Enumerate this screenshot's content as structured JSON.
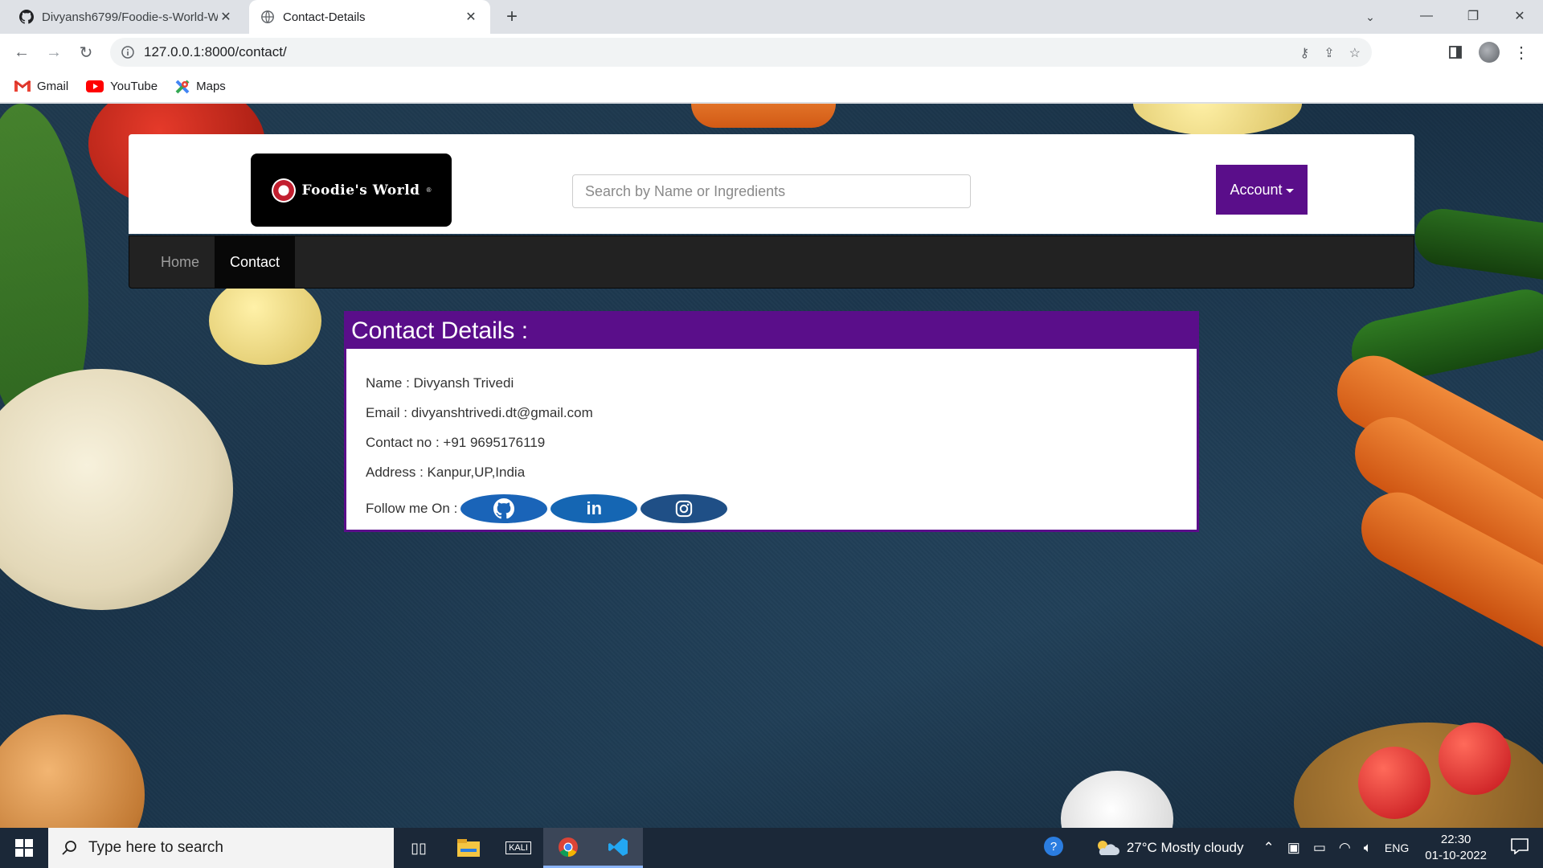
{
  "browser": {
    "tabs": [
      {
        "title": "Divyansh6799/Foodie-s-World-W",
        "active": false
      },
      {
        "title": "Contact-Details",
        "active": true
      }
    ],
    "url": "127.0.0.1:8000/contact/",
    "bookmarks": [
      "Gmail",
      "YouTube",
      "Maps"
    ]
  },
  "site": {
    "logo_text": "Foodie's World",
    "logo_mark": "®",
    "search_placeholder": "Search by Name or Ingredients",
    "account_label": "Account",
    "nav": [
      {
        "label": "Home",
        "active": false
      },
      {
        "label": "Contact",
        "active": true
      }
    ]
  },
  "contact": {
    "heading": "Contact Details :",
    "name_label": "Name : ",
    "name": "Divyansh Trivedi",
    "email_label": "Email : ",
    "email": "divyanshtrivedi.dt@gmail.com",
    "phone_label": "Contact no : ",
    "phone": "+91 9695176119",
    "address_label": "Address : ",
    "address": "Kanpur,UP,India",
    "follow_label": "Follow me On : ",
    "social": [
      "github-icon",
      "linkedin-icon",
      "instagram-icon"
    ],
    "linkedin_text": "in"
  },
  "taskbar": {
    "search_placeholder": "Type here to search",
    "weather": "27°C  Mostly cloudy",
    "lang": "ENG",
    "time": "22:30",
    "date": "01-10-2022",
    "kali_label": "KALI"
  },
  "colors": {
    "accent_purple": "#5a0e8a",
    "navbar": "#222222",
    "social_blue": "#1a64b8"
  }
}
